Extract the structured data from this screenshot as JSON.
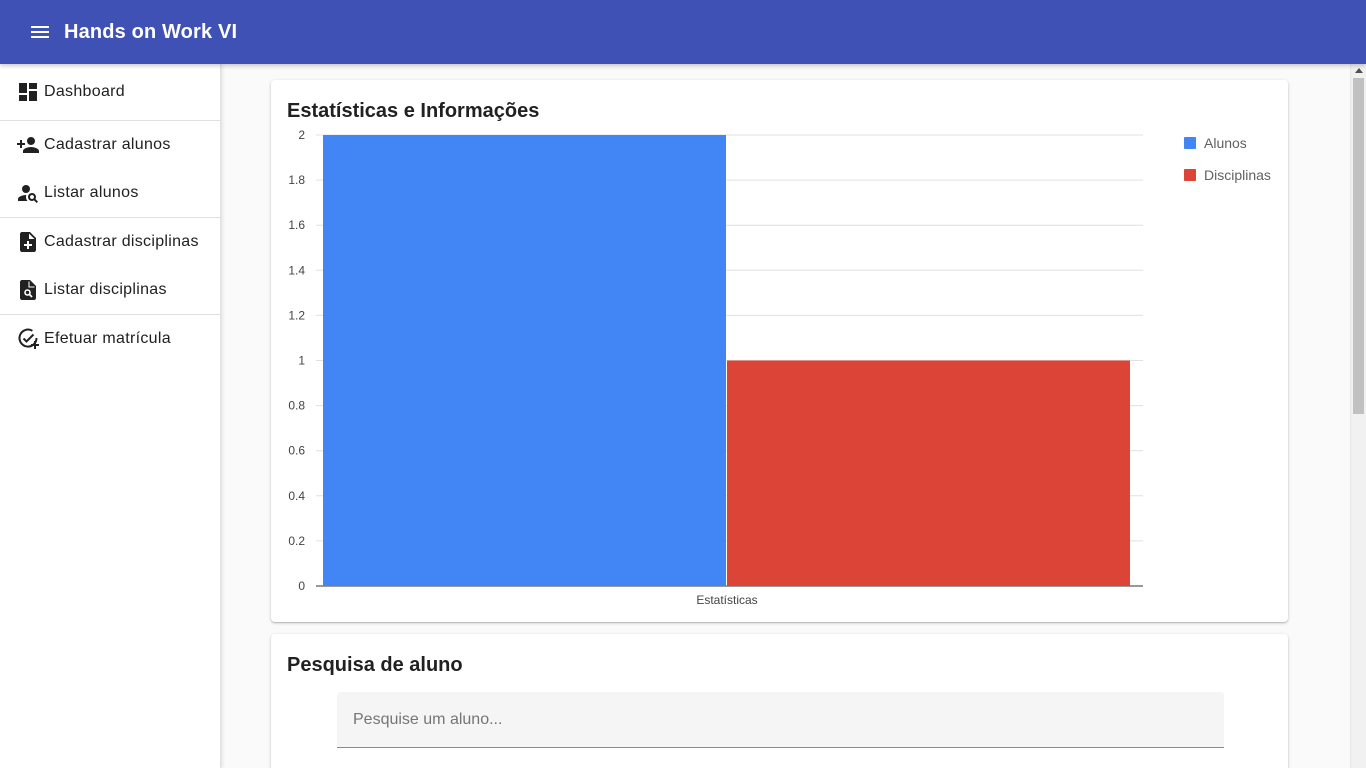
{
  "app": {
    "title": "Hands on Work VI"
  },
  "sidebar": {
    "items": [
      {
        "label": "Dashboard",
        "icon": "dashboard-icon"
      },
      {
        "label": "Cadastrar alunos",
        "icon": "person-add-icon"
      },
      {
        "label": "Listar alunos",
        "icon": "person-search-icon"
      },
      {
        "label": "Cadastrar disciplinas",
        "icon": "note-add-icon"
      },
      {
        "label": "Listar disciplinas",
        "icon": "file-search-icon"
      },
      {
        "label": "Efetuar matrícula",
        "icon": "add-task-icon"
      }
    ]
  },
  "stats_card": {
    "title": "Estatísticas e Informações"
  },
  "search_card": {
    "title": "Pesquisa de aluno",
    "placeholder": "Pesquise um aluno..."
  },
  "colors": {
    "primary": "#3f51b5",
    "alunos": "#4285f4",
    "disciplinas": "#db4437"
  },
  "chart_data": {
    "type": "bar",
    "categories": [
      "Estatísticas"
    ],
    "series": [
      {
        "name": "Alunos",
        "values": [
          2
        ],
        "color": "#4285f4"
      },
      {
        "name": "Disciplinas",
        "values": [
          1
        ],
        "color": "#db4437"
      }
    ],
    "ylim": [
      0,
      2
    ],
    "yticks": [
      "0",
      "0.2",
      "0.4",
      "0.6",
      "0.8",
      "1",
      "1.2",
      "1.4",
      "1.6",
      "1.8",
      "2"
    ],
    "grid": true,
    "legend": "right"
  }
}
